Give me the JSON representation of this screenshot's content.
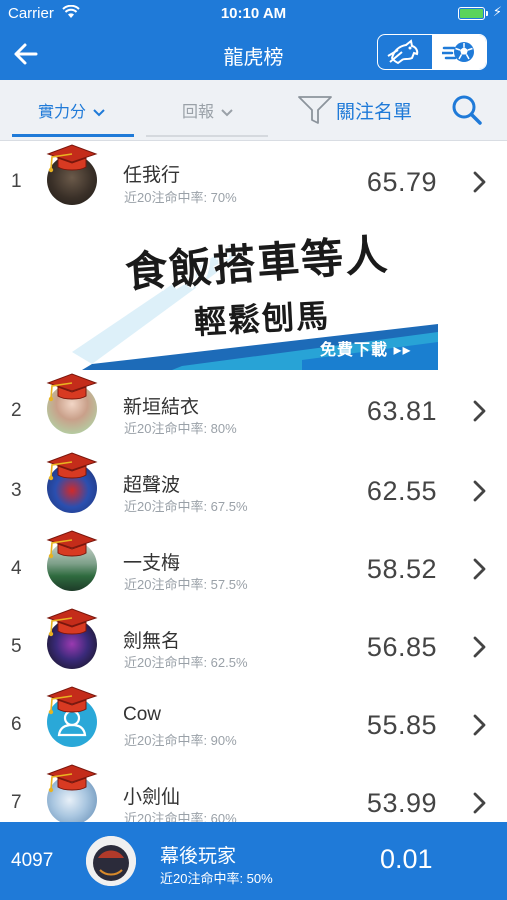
{
  "status_bar": {
    "carrier": "Carrier",
    "time": "10:10 AM",
    "battery_level": 1.0
  },
  "nav": {
    "title": "龍虎榜"
  },
  "filters": {
    "strength": "實力分",
    "return": "回報",
    "watchlist": "關注名單"
  },
  "ad": {
    "line1": "食飯搭車等人",
    "line2": "輕鬆刨馬",
    "cta": "免費下載"
  },
  "rows": [
    {
      "rank": "1",
      "name": "任我行",
      "hit_rate": "近20注命中率: 70%",
      "score": "65.79"
    },
    {
      "rank": "2",
      "name": "新垣結衣",
      "hit_rate": "近20注命中率: 80%",
      "score": "63.81"
    },
    {
      "rank": "3",
      "name": "超聲波",
      "hit_rate": "近20注命中率: 67.5%",
      "score": "62.55"
    },
    {
      "rank": "4",
      "name": "一支梅",
      "hit_rate": "近20注命中率: 57.5%",
      "score": "58.52"
    },
    {
      "rank": "5",
      "name": "劍無名",
      "hit_rate": "近20注命中率: 62.5%",
      "score": "56.85"
    },
    {
      "rank": "6",
      "name": "Cow",
      "hit_rate": "近20注命中率: 90%",
      "score": "55.85"
    },
    {
      "rank": "7",
      "name": "小劍仙",
      "hit_rate": "近20注命中率: 60%",
      "score": "53.99"
    }
  ],
  "me": {
    "rank": "4097",
    "name": "幕後玩家",
    "hit_rate": "近20注命中率: 50%",
    "score": "0.01"
  },
  "colors": {
    "primary": "#1f7ad8",
    "filter_bg": "#eef1f5",
    "muted": "#9aa1a8",
    "hat": "#c42c1a"
  },
  "icons": {
    "back": "arrow-left-icon",
    "horse": "horse-icon",
    "football": "football-icon",
    "chevron_down": "chevron-down-icon",
    "filter": "filter-icon",
    "search": "search-icon",
    "chevron_right": "chevron-right-icon",
    "hat": "graduation-cap-icon",
    "wifi": "wifi-icon"
  }
}
